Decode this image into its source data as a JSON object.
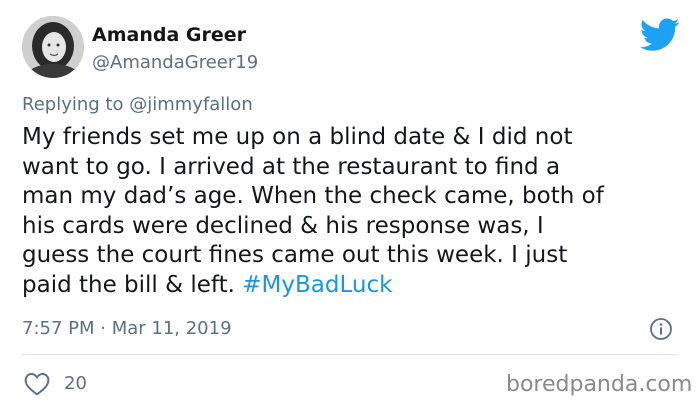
{
  "author": {
    "display_name": "Amanda Greer",
    "handle": "@AmandaGreer19",
    "avatar_icon": "profile-photo"
  },
  "brand": {
    "icon": "twitter-bird-icon",
    "color": "#1da1f2"
  },
  "reply": {
    "prefix": "Replying to",
    "mention": "@jimmyfallon"
  },
  "tweet": {
    "text_lines": [
      "My friends set me up on a blind date & I did not",
      "want to go. I arrived at the restaurant to find a",
      "man my dad’s age. When the check came, both of",
      "his cards were declined & his response was, I",
      "guess the court fines came out this week. I just"
    ],
    "last_line_text": "paid the bill & left.",
    "hashtag": "#MyBadLuck",
    "hashtag_color": "#1b95e0"
  },
  "meta": {
    "timestamp": "7:57 PM · Mar 11, 2019",
    "info_icon": "info-icon"
  },
  "engagement": {
    "like_icon": "heart-icon",
    "like_count": "20"
  },
  "watermark": "boredpanda.com"
}
